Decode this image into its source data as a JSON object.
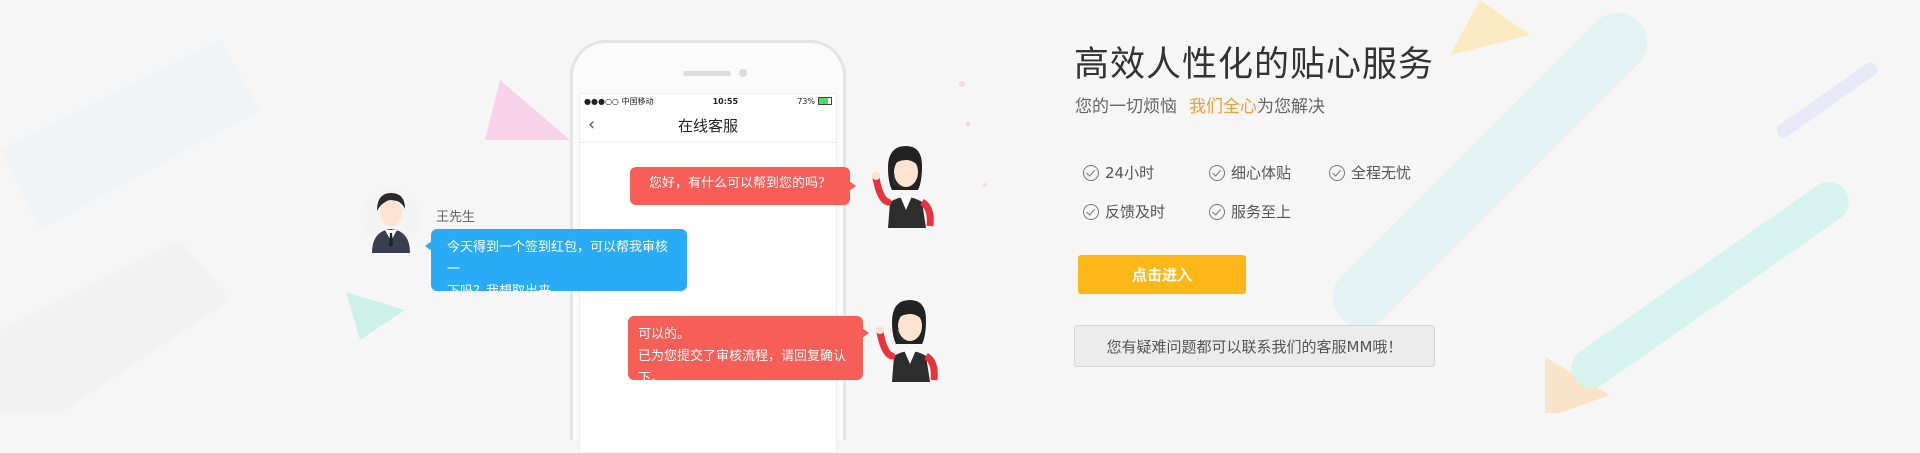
{
  "colors": {
    "accent_orange": "#f19d3c",
    "button_yellow": "#fdb718",
    "bubble_red": "#f65e57",
    "bubble_blue": "#2aabf5"
  },
  "phone": {
    "status": {
      "carrier": "●●●○○ 中国移动",
      "time": "10:55",
      "battery": "73%"
    },
    "nav_title": "在线客服",
    "back_icon": "chevron-left-icon"
  },
  "chat": {
    "agent_greeting": "您好，有什么可以帮到您的吗？",
    "user_name": "王先生",
    "user_message_line1": "今天得到一个签到红包，可以帮我审核一",
    "user_message_line2": "下吗？我想取出来。",
    "agent_reply_line1": "可以的。",
    "agent_reply_line2": "已为您提交了审核流程，请回复确认下。"
  },
  "hero": {
    "headline": "高效人性化的贴心服务",
    "sub_prefix": "您的一切烦恼",
    "sub_highlight": "我们全心",
    "sub_suffix": "为您解决"
  },
  "features": [
    "24小时",
    "细心体贴",
    "全程无忧",
    "反馈及时",
    "服务至上"
  ],
  "buttons": {
    "enter": "点击进入",
    "contact": "您有疑难问题都可以联系我们的客服MM哦！"
  }
}
